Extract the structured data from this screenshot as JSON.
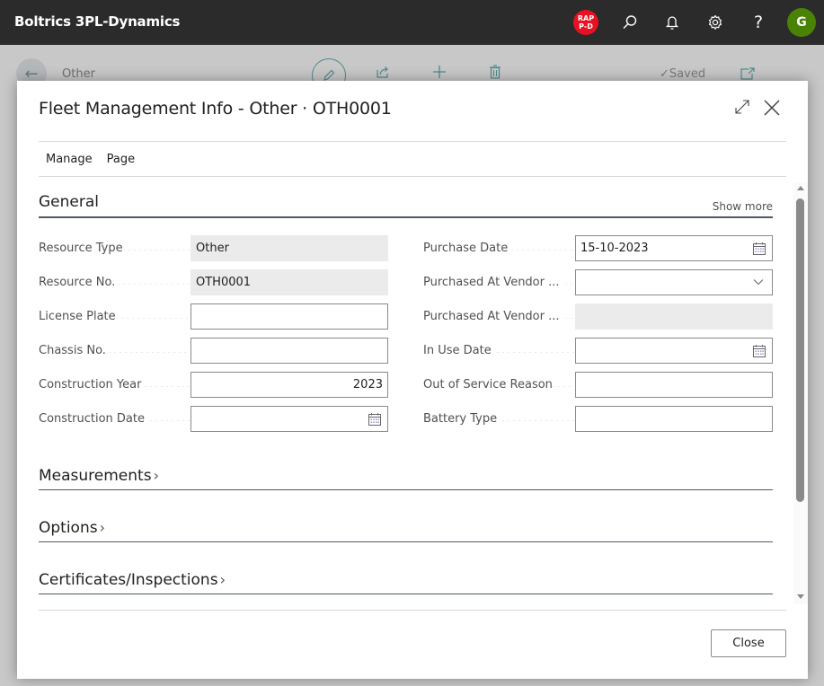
{
  "topbar": {
    "app_title": "Boltrics 3PL-Dynamics",
    "environment_badge_line1": "RAP",
    "environment_badge_line2": "P-D",
    "avatar_initial": "G",
    "icons": [
      "search-icon",
      "bell-icon",
      "gear-icon",
      "help-icon"
    ]
  },
  "background_page": {
    "title": "Other",
    "status": "Saved",
    "actions": [
      "edit-icon",
      "share-icon",
      "add-icon",
      "delete-icon",
      "open-new-window-icon"
    ]
  },
  "dialog": {
    "title": "Fleet Management Info - Other · OTH0001",
    "menu": [
      "Manage",
      "Page"
    ],
    "sections": {
      "general": {
        "title": "General",
        "show_more": "Show more",
        "left_fields": [
          {
            "label": "Resource Type",
            "value": "Other",
            "readonly": true
          },
          {
            "label": "Resource No.",
            "value": "OTH0001",
            "readonly": true
          },
          {
            "label": "License Plate",
            "value": ""
          },
          {
            "label": "Chassis No.",
            "value": ""
          },
          {
            "label": "Construction Year",
            "value": "2023"
          },
          {
            "label": "Construction Date",
            "value": ""
          }
        ],
        "right_fields": [
          {
            "label": "Purchase Date",
            "value": "15-10-2023"
          },
          {
            "label": "Purchased At Vendor ...",
            "value": ""
          },
          {
            "label": "Purchased At Vendor ...",
            "value": "",
            "readonly": true
          },
          {
            "label": "In Use Date",
            "value": ""
          },
          {
            "label": "Out of Service Reason",
            "value": ""
          },
          {
            "label": "Battery Type",
            "value": ""
          }
        ]
      },
      "collapsed": [
        {
          "title": "Measurements"
        },
        {
          "title": "Options"
        },
        {
          "title": "Certificates/Inspections"
        }
      ]
    },
    "close_label": "Close"
  },
  "colors": {
    "topbar_bg": "#2b2b2b",
    "badge_red": "#e81123",
    "avatar_green": "#498205",
    "accent_teal": "#4f8a8b"
  }
}
